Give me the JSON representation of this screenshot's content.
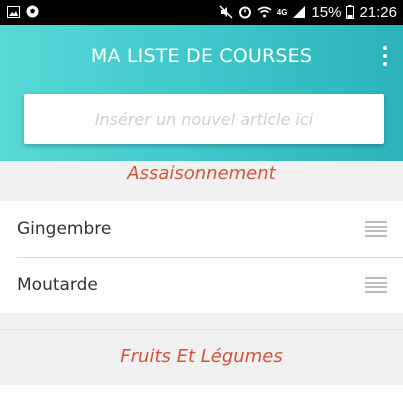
{
  "status_bar": {
    "left_icons": [
      "image-icon",
      "soccer-ball-icon"
    ],
    "right_icons": [
      "mute-icon",
      "alarm-icon",
      "wifi-icon",
      "network-4g-icon",
      "signal-icon",
      "battery-icon"
    ],
    "network_label": "4G",
    "battery_percent": "15%",
    "time": "21:26"
  },
  "header": {
    "title": "MA LISTE DE COURSES",
    "menu_icon": "overflow-menu-icon",
    "gradient_start": "#58d8d8",
    "gradient_end": "#2bb3b9"
  },
  "new_item": {
    "placeholder": "Insérer un nouvel article ici",
    "value": ""
  },
  "categories": [
    {
      "name": "Assaisonnement",
      "items": [
        {
          "label": "Gingembre"
        },
        {
          "label": "Moutarde"
        }
      ]
    },
    {
      "name": "Fruits Et Légumes",
      "items": []
    }
  ],
  "colors": {
    "category_text": "#d6533a",
    "item_text": "#333333",
    "section_bg": "#f1f1f1"
  }
}
